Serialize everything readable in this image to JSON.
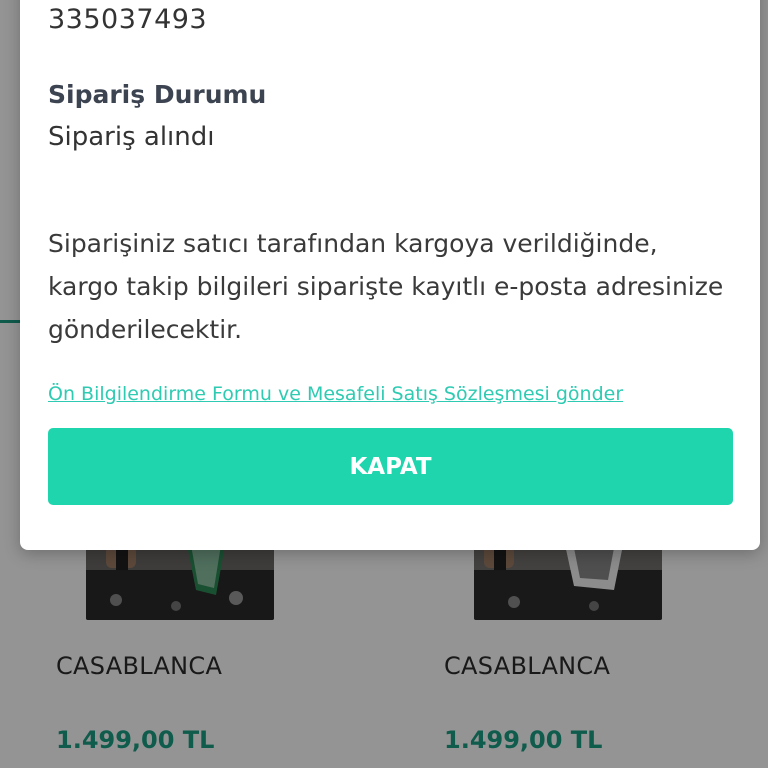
{
  "modal": {
    "order_number": "335037493",
    "status_title": "Sipariş Durumu",
    "status_value": "Sipariş alındı",
    "info_text": "Siparişiniz satıcı tarafından kargoya verildiğinde, kargo takip bilgileri siparişte kayıtlı e-posta adresinize gönderilecektir.",
    "form_link": "Ön Bilgilendirme Formu ve Mesafeli Satış Sözleşmesi gönder",
    "close_label": "KAPAT"
  },
  "products": [
    {
      "name": "CASABLANCA",
      "price": "1.499,00 TL"
    },
    {
      "name": "CASABLANCA",
      "price": "1.499,00 TL"
    }
  ],
  "colors": {
    "accent": "#1ed5ae",
    "link": "#2ecbb2",
    "price": "#1a9e84"
  }
}
